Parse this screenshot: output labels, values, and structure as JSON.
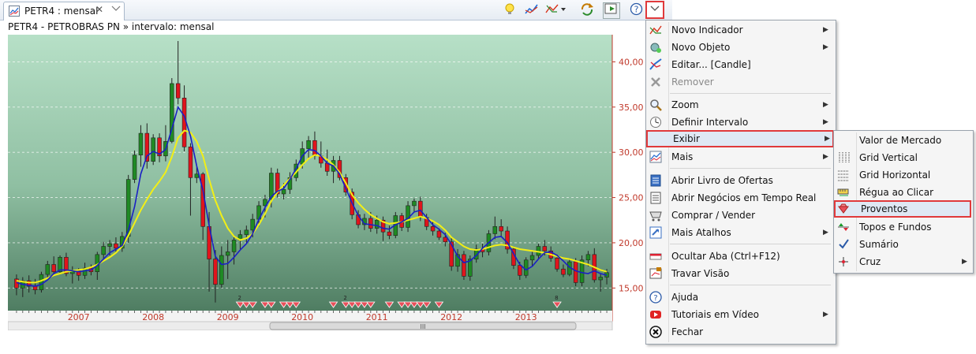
{
  "tab": {
    "title": "PETR4 : mensal",
    "close": "✕"
  },
  "chart_header": "PETR4 - PETROBRAS PN » intervalo: mensal",
  "chart_data": {
    "type": "candlestick",
    "x_labels": [
      "2007",
      "2008",
      "2009",
      "2010",
      "2011",
      "2012",
      "2013"
    ],
    "y_ticks": [
      "40,00",
      "35,00",
      "30,00",
      "25,00",
      "20,00",
      "15,00"
    ],
    "y_values": [
      40,
      35,
      30,
      25,
      20,
      15
    ],
    "ylim": [
      12.5,
      43
    ],
    "grid": true,
    "scrollbar_grip": "III",
    "proventos_counts": [
      "2",
      "2",
      "8"
    ],
    "candles": [
      {
        "o": 16.0,
        "h": 16.5,
        "l": 14.2,
        "c": 15.0
      },
      {
        "o": 15.0,
        "h": 16.2,
        "l": 14.0,
        "c": 15.8
      },
      {
        "o": 15.8,
        "h": 16.4,
        "l": 14.5,
        "c": 15.2
      },
      {
        "o": 15.2,
        "h": 16.0,
        "l": 14.3,
        "c": 14.8
      },
      {
        "o": 14.8,
        "h": 16.8,
        "l": 14.5,
        "c": 16.5
      },
      {
        "o": 16.5,
        "h": 18.0,
        "l": 16.0,
        "c": 17.6
      },
      {
        "o": 17.6,
        "h": 18.5,
        "l": 16.4,
        "c": 16.8
      },
      {
        "o": 16.8,
        "h": 18.6,
        "l": 16.5,
        "c": 18.4
      },
      {
        "o": 18.4,
        "h": 18.9,
        "l": 16.3,
        "c": 16.6
      },
      {
        "o": 16.6,
        "h": 17.4,
        "l": 15.5,
        "c": 16.9
      },
      {
        "o": 16.9,
        "h": 17.2,
        "l": 15.8,
        "c": 16.4
      },
      {
        "o": 16.4,
        "h": 17.8,
        "l": 16.0,
        "c": 17.2
      },
      {
        "o": 17.2,
        "h": 17.6,
        "l": 16.4,
        "c": 16.8
      },
      {
        "o": 16.8,
        "h": 19.0,
        "l": 15.9,
        "c": 18.7
      },
      {
        "o": 18.7,
        "h": 20.1,
        "l": 18.0,
        "c": 19.6
      },
      {
        "o": 19.6,
        "h": 20.3,
        "l": 18.6,
        "c": 19.9
      },
      {
        "o": 19.9,
        "h": 20.6,
        "l": 19.0,
        "c": 19.4
      },
      {
        "o": 19.4,
        "h": 21.2,
        "l": 19.0,
        "c": 20.7
      },
      {
        "o": 20.7,
        "h": 27.5,
        "l": 20.0,
        "c": 27.0
      },
      {
        "o": 27.0,
        "h": 30.2,
        "l": 26.6,
        "c": 29.7
      },
      {
        "o": 29.7,
        "h": 33.0,
        "l": 28.4,
        "c": 32.1
      },
      {
        "o": 32.1,
        "h": 33.2,
        "l": 28.2,
        "c": 29.0
      },
      {
        "o": 29.0,
        "h": 32.0,
        "l": 28.6,
        "c": 31.6
      },
      {
        "o": 31.6,
        "h": 32.1,
        "l": 28.9,
        "c": 29.6
      },
      {
        "o": 29.6,
        "h": 33.0,
        "l": 29.0,
        "c": 31.2
      },
      {
        "o": 31.2,
        "h": 38.2,
        "l": 31.0,
        "c": 37.6
      },
      {
        "o": 37.6,
        "h": 42.3,
        "l": 35.3,
        "c": 36.0
      },
      {
        "o": 36.0,
        "h": 37.4,
        "l": 30.1,
        "c": 30.6
      },
      {
        "o": 30.6,
        "h": 31.0,
        "l": 23.0,
        "c": 27.2
      },
      {
        "o": 27.2,
        "h": 28.4,
        "l": 26.6,
        "c": 27.6
      },
      {
        "o": 27.6,
        "h": 27.8,
        "l": 20.3,
        "c": 21.8
      },
      {
        "o": 21.8,
        "h": 23.4,
        "l": 14.6,
        "c": 18.2
      },
      {
        "o": 18.2,
        "h": 19.2,
        "l": 13.4,
        "c": 15.4
      },
      {
        "o": 15.4,
        "h": 19.6,
        "l": 15.0,
        "c": 18.6
      },
      {
        "o": 18.6,
        "h": 20.3,
        "l": 16.0,
        "c": 19.0
      },
      {
        "o": 19.0,
        "h": 20.6,
        "l": 17.6,
        "c": 20.3
      },
      {
        "o": 20.3,
        "h": 21.4,
        "l": 19.3,
        "c": 20.9
      },
      {
        "o": 20.9,
        "h": 21.9,
        "l": 19.9,
        "c": 21.4
      },
      {
        "o": 21.4,
        "h": 23.2,
        "l": 20.6,
        "c": 22.6
      },
      {
        "o": 22.6,
        "h": 24.6,
        "l": 21.8,
        "c": 24.1
      },
      {
        "o": 24.1,
        "h": 25.3,
        "l": 22.8,
        "c": 24.8
      },
      {
        "o": 24.8,
        "h": 28.3,
        "l": 23.9,
        "c": 27.7
      },
      {
        "o": 27.7,
        "h": 28.2,
        "l": 25.0,
        "c": 25.4
      },
      {
        "o": 25.4,
        "h": 26.6,
        "l": 24.8,
        "c": 25.9
      },
      {
        "o": 25.9,
        "h": 27.8,
        "l": 25.4,
        "c": 27.2
      },
      {
        "o": 27.2,
        "h": 29.2,
        "l": 26.8,
        "c": 28.7
      },
      {
        "o": 28.7,
        "h": 31.2,
        "l": 28.2,
        "c": 30.4
      },
      {
        "o": 30.4,
        "h": 31.8,
        "l": 29.2,
        "c": 31.3
      },
      {
        "o": 31.3,
        "h": 32.3,
        "l": 29.2,
        "c": 29.6
      },
      {
        "o": 29.6,
        "h": 31.2,
        "l": 28.3,
        "c": 28.8
      },
      {
        "o": 28.8,
        "h": 30.3,
        "l": 27.4,
        "c": 27.9
      },
      {
        "o": 27.9,
        "h": 29.6,
        "l": 26.6,
        "c": 29.1
      },
      {
        "o": 29.1,
        "h": 29.6,
        "l": 26.9,
        "c": 27.2
      },
      {
        "o": 27.2,
        "h": 27.6,
        "l": 25.2,
        "c": 25.6
      },
      {
        "o": 25.6,
        "h": 26.0,
        "l": 22.6,
        "c": 23.1
      },
      {
        "o": 23.1,
        "h": 23.6,
        "l": 21.6,
        "c": 22.0
      },
      {
        "o": 22.0,
        "h": 23.2,
        "l": 21.4,
        "c": 22.7
      },
      {
        "o": 22.7,
        "h": 23.4,
        "l": 21.2,
        "c": 21.6
      },
      {
        "o": 21.6,
        "h": 23.0,
        "l": 21.0,
        "c": 22.5
      },
      {
        "o": 22.5,
        "h": 22.9,
        "l": 20.2,
        "c": 21.2
      },
      {
        "o": 21.2,
        "h": 21.9,
        "l": 20.4,
        "c": 20.8
      },
      {
        "o": 20.8,
        "h": 23.4,
        "l": 20.5,
        "c": 23.0
      },
      {
        "o": 23.0,
        "h": 23.3,
        "l": 21.3,
        "c": 21.7
      },
      {
        "o": 21.7,
        "h": 24.6,
        "l": 21.2,
        "c": 24.1
      },
      {
        "o": 24.1,
        "h": 24.9,
        "l": 23.4,
        "c": 24.6
      },
      {
        "o": 24.6,
        "h": 25.1,
        "l": 22.4,
        "c": 22.8
      },
      {
        "o": 22.8,
        "h": 23.2,
        "l": 21.4,
        "c": 21.8
      },
      {
        "o": 21.8,
        "h": 22.3,
        "l": 20.8,
        "c": 21.3
      },
      {
        "o": 21.3,
        "h": 21.6,
        "l": 20.3,
        "c": 20.6
      },
      {
        "o": 20.6,
        "h": 21.1,
        "l": 19.6,
        "c": 20.1
      },
      {
        "o": 20.1,
        "h": 20.6,
        "l": 16.9,
        "c": 17.4
      },
      {
        "o": 17.4,
        "h": 19.3,
        "l": 16.8,
        "c": 18.7
      },
      {
        "o": 18.7,
        "h": 19.1,
        "l": 15.9,
        "c": 16.3
      },
      {
        "o": 16.3,
        "h": 18.6,
        "l": 15.8,
        "c": 18.2
      },
      {
        "o": 18.2,
        "h": 19.8,
        "l": 17.8,
        "c": 19.3
      },
      {
        "o": 19.3,
        "h": 19.9,
        "l": 18.4,
        "c": 19.0
      },
      {
        "o": 19.0,
        "h": 21.4,
        "l": 18.6,
        "c": 21.0
      },
      {
        "o": 21.0,
        "h": 22.9,
        "l": 20.4,
        "c": 21.8
      },
      {
        "o": 21.8,
        "h": 22.6,
        "l": 20.7,
        "c": 21.3
      },
      {
        "o": 21.3,
        "h": 21.8,
        "l": 18.8,
        "c": 19.3
      },
      {
        "o": 19.3,
        "h": 19.6,
        "l": 17.1,
        "c": 17.5
      },
      {
        "o": 17.5,
        "h": 17.9,
        "l": 15.9,
        "c": 16.4
      },
      {
        "o": 16.4,
        "h": 18.4,
        "l": 16.1,
        "c": 18.1
      },
      {
        "o": 18.1,
        "h": 19.0,
        "l": 17.4,
        "c": 18.6
      },
      {
        "o": 18.6,
        "h": 19.9,
        "l": 18.2,
        "c": 19.6
      },
      {
        "o": 19.6,
        "h": 20.3,
        "l": 18.6,
        "c": 19.1
      },
      {
        "o": 19.1,
        "h": 19.6,
        "l": 17.9,
        "c": 18.3
      },
      {
        "o": 18.3,
        "h": 18.7,
        "l": 16.8,
        "c": 17.1
      },
      {
        "o": 17.1,
        "h": 17.6,
        "l": 16.2,
        "c": 16.5
      },
      {
        "o": 16.5,
        "h": 18.3,
        "l": 16.3,
        "c": 17.9
      },
      {
        "o": 17.9,
        "h": 18.3,
        "l": 15.2,
        "c": 15.6
      },
      {
        "o": 15.6,
        "h": 18.6,
        "l": 15.2,
        "c": 18.1
      },
      {
        "o": 18.1,
        "h": 19.1,
        "l": 17.4,
        "c": 18.7
      },
      {
        "o": 18.7,
        "h": 19.4,
        "l": 15.6,
        "c": 15.9
      },
      {
        "o": 15.9,
        "h": 16.6,
        "l": 14.6,
        "c": 16.2
      },
      {
        "o": 16.2,
        "h": 17.1,
        "l": 15.4,
        "c": 16.7
      }
    ],
    "ma_yellow": [
      15.8,
      15.7,
      15.6,
      15.6,
      15.8,
      16.1,
      16.4,
      16.6,
      16.8,
      16.9,
      17.0,
      17.1,
      17.3,
      17.6,
      18.0,
      18.4,
      18.9,
      19.6,
      20.8,
      22.2,
      23.6,
      24.8,
      25.9,
      26.8,
      27.8,
      29.5,
      31.6,
      32.4,
      32.2,
      31.2,
      29.6,
      27.0,
      24.7,
      23.0,
      21.6,
      20.7,
      20.3,
      20.5,
      21.0,
      22.0,
      23.2,
      24.6,
      25.6,
      26.4,
      27.1,
      27.8,
      28.6,
      29.3,
      29.7,
      29.6,
      29.2,
      28.6,
      27.8,
      26.6,
      25.3,
      24.4,
      23.7,
      23.1,
      22.7,
      22.3,
      22.1,
      22.2,
      22.3,
      22.5,
      22.7,
      22.9,
      22.7,
      22.4,
      22.0,
      21.4,
      20.6,
      20.1,
      19.6,
      19.3,
      19.2,
      19.3,
      19.5,
      19.7,
      19.8,
      19.7,
      19.5,
      19.3,
      19.2,
      19.1,
      19.0,
      18.9,
      18.7,
      18.5,
      18.3,
      18.2,
      18.0,
      17.8,
      17.6,
      17.3,
      17.0,
      16.8
    ],
    "ma_blue": [
      15.6,
      15.4,
      15.3,
      15.2,
      15.4,
      15.9,
      16.6,
      17.0,
      17.0,
      16.9,
      16.8,
      16.9,
      17.0,
      17.5,
      18.2,
      18.9,
      19.3,
      19.7,
      21.4,
      24.0,
      27.6,
      29.6,
      30.1,
      29.8,
      30.3,
      32.6,
      35.0,
      34.0,
      31.8,
      28.5,
      25.8,
      21.9,
      18.5,
      17.6,
      17.7,
      18.4,
      19.2,
      19.9,
      21.0,
      22.6,
      23.9,
      25.1,
      25.7,
      26.0,
      27.0,
      28.2,
      29.6,
      30.3,
      30.2,
      29.6,
      28.8,
      28.5,
      27.6,
      26.0,
      24.4,
      23.0,
      22.1,
      22.0,
      21.9,
      21.6,
      21.5,
      22.0,
      22.3,
      22.7,
      23.4,
      23.6,
      22.8,
      22.0,
      21.5,
      20.9,
      19.8,
      18.5,
      17.8,
      18.0,
      18.6,
      19.4,
      20.0,
      20.6,
      20.7,
      20.0,
      18.8,
      17.6,
      17.0,
      17.4,
      18.2,
      18.9,
      19.0,
      18.6,
      18.0,
      17.3,
      16.9,
      16.7,
      16.6,
      16.9,
      16.6,
      16.4
    ]
  },
  "toolbar": {
    "icons": [
      "lightbulb-icon",
      "indicator-icon",
      "indicator-dropdown-icon",
      "refresh-icon",
      "export-icon",
      "help-icon",
      "view-menu-icon"
    ]
  },
  "menu": {
    "items": [
      {
        "label": "Novo Indicador",
        "submenu": true
      },
      {
        "label": "Novo Objeto",
        "submenu": true
      },
      {
        "label": "Editar... [Candle]",
        "submenu": false
      },
      {
        "label": "Remover",
        "submenu": false,
        "disabled": true
      },
      {
        "label": "Zoom",
        "submenu": true
      },
      {
        "label": "Definir Intervalo",
        "submenu": true
      },
      {
        "label": "Exibir",
        "submenu": true,
        "highlighted": true
      },
      {
        "label": "Mais",
        "submenu": true
      },
      {
        "label": "Abrir Livro de Ofertas",
        "submenu": false
      },
      {
        "label": "Abrir Negócios em Tempo Real",
        "submenu": false
      },
      {
        "label": "Comprar / Vender",
        "submenu": false
      },
      {
        "label": "Mais Atalhos",
        "submenu": true
      },
      {
        "label": "Ocultar Aba (Ctrl+F12)",
        "submenu": false
      },
      {
        "label": "Travar Visão",
        "submenu": false
      },
      {
        "label": "Ajuda",
        "submenu": false
      },
      {
        "label": "Tutoriais em Vídeo",
        "submenu": true
      },
      {
        "label": "Fechar",
        "submenu": false
      }
    ]
  },
  "submenu": {
    "items": [
      {
        "label": "Valor de Mercado",
        "submenu": false
      },
      {
        "label": "Grid Vertical",
        "submenu": false
      },
      {
        "label": "Grid Horizontal",
        "submenu": false
      },
      {
        "label": "Régua ao Clicar",
        "submenu": false
      },
      {
        "label": "Proventos",
        "submenu": false,
        "highlighted": true
      },
      {
        "label": "Topos e Fundos",
        "submenu": false
      },
      {
        "label": "Sumário",
        "submenu": false,
        "checked": true
      },
      {
        "label": "Cruz",
        "submenu": true
      }
    ]
  },
  "colors": {
    "up": "#1f8a24",
    "down": "#e0141c",
    "ma_short": "#1a1fc4",
    "ma_long": "#f2ef16",
    "highlight_border": "#e0393b"
  }
}
